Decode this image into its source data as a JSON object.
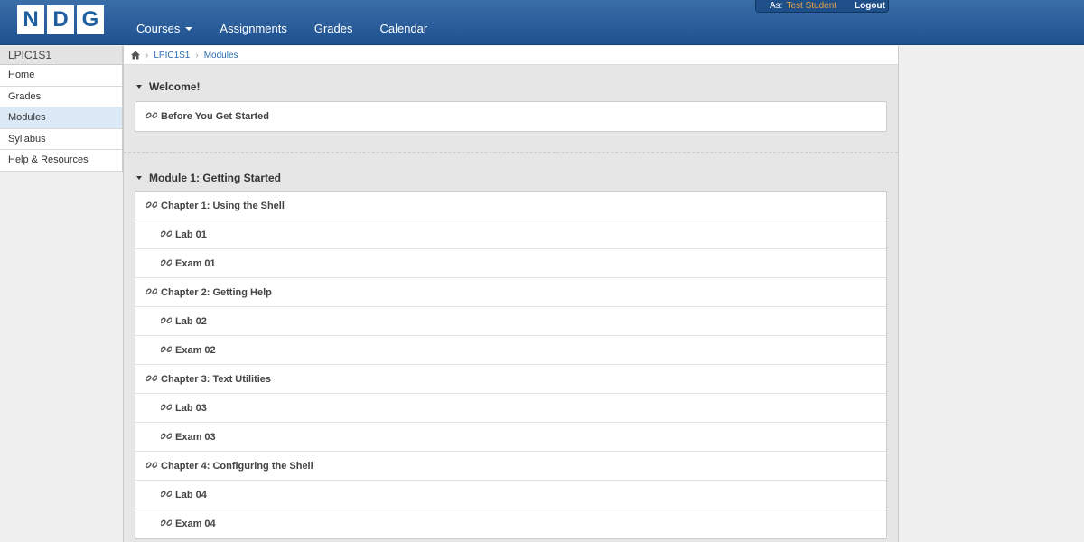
{
  "logo": {
    "letters": [
      "N",
      "D",
      "G"
    ]
  },
  "nav": {
    "items": [
      {
        "label": "Courses",
        "dropdown": true
      },
      {
        "label": "Assignments",
        "dropdown": false
      },
      {
        "label": "Grades",
        "dropdown": false
      },
      {
        "label": "Calendar",
        "dropdown": false
      }
    ]
  },
  "user": {
    "as_label": "As:",
    "name": "Test Student",
    "logout": "Logout"
  },
  "sidebar": {
    "course": "LPIC1S1",
    "items": [
      {
        "label": "Home",
        "active": false
      },
      {
        "label": "Grades",
        "active": false
      },
      {
        "label": "Modules",
        "active": true
      },
      {
        "label": "Syllabus",
        "active": false
      },
      {
        "label": "Help & Resources",
        "active": false
      }
    ]
  },
  "breadcrumb": {
    "course": "LPIC1S1",
    "page": "Modules"
  },
  "modules": [
    {
      "title": "Welcome!",
      "items": [
        {
          "label": "Before You Get Started",
          "indent": false
        }
      ]
    },
    {
      "title": "Module 1: Getting Started",
      "items": [
        {
          "label": "Chapter 1: Using the Shell",
          "indent": false
        },
        {
          "label": "Lab 01",
          "indent": true
        },
        {
          "label": "Exam 01",
          "indent": true
        },
        {
          "label": "Chapter 2: Getting Help",
          "indent": false
        },
        {
          "label": "Lab 02",
          "indent": true
        },
        {
          "label": "Exam 02",
          "indent": true
        },
        {
          "label": "Chapter 3: Text Utilities",
          "indent": false
        },
        {
          "label": "Lab 03",
          "indent": true
        },
        {
          "label": "Exam 03",
          "indent": true
        },
        {
          "label": "Chapter 4: Configuring the Shell",
          "indent": false
        },
        {
          "label": "Lab 04",
          "indent": true
        },
        {
          "label": "Exam 04",
          "indent": true
        }
      ]
    }
  ],
  "colors": {
    "header": "#2a5f9e",
    "accent_user": "#f0a040",
    "link": "#2a6ab0"
  },
  "icons": {
    "home": "home-icon",
    "item": "link-icon",
    "collapse": "collapse-triangle-icon"
  }
}
